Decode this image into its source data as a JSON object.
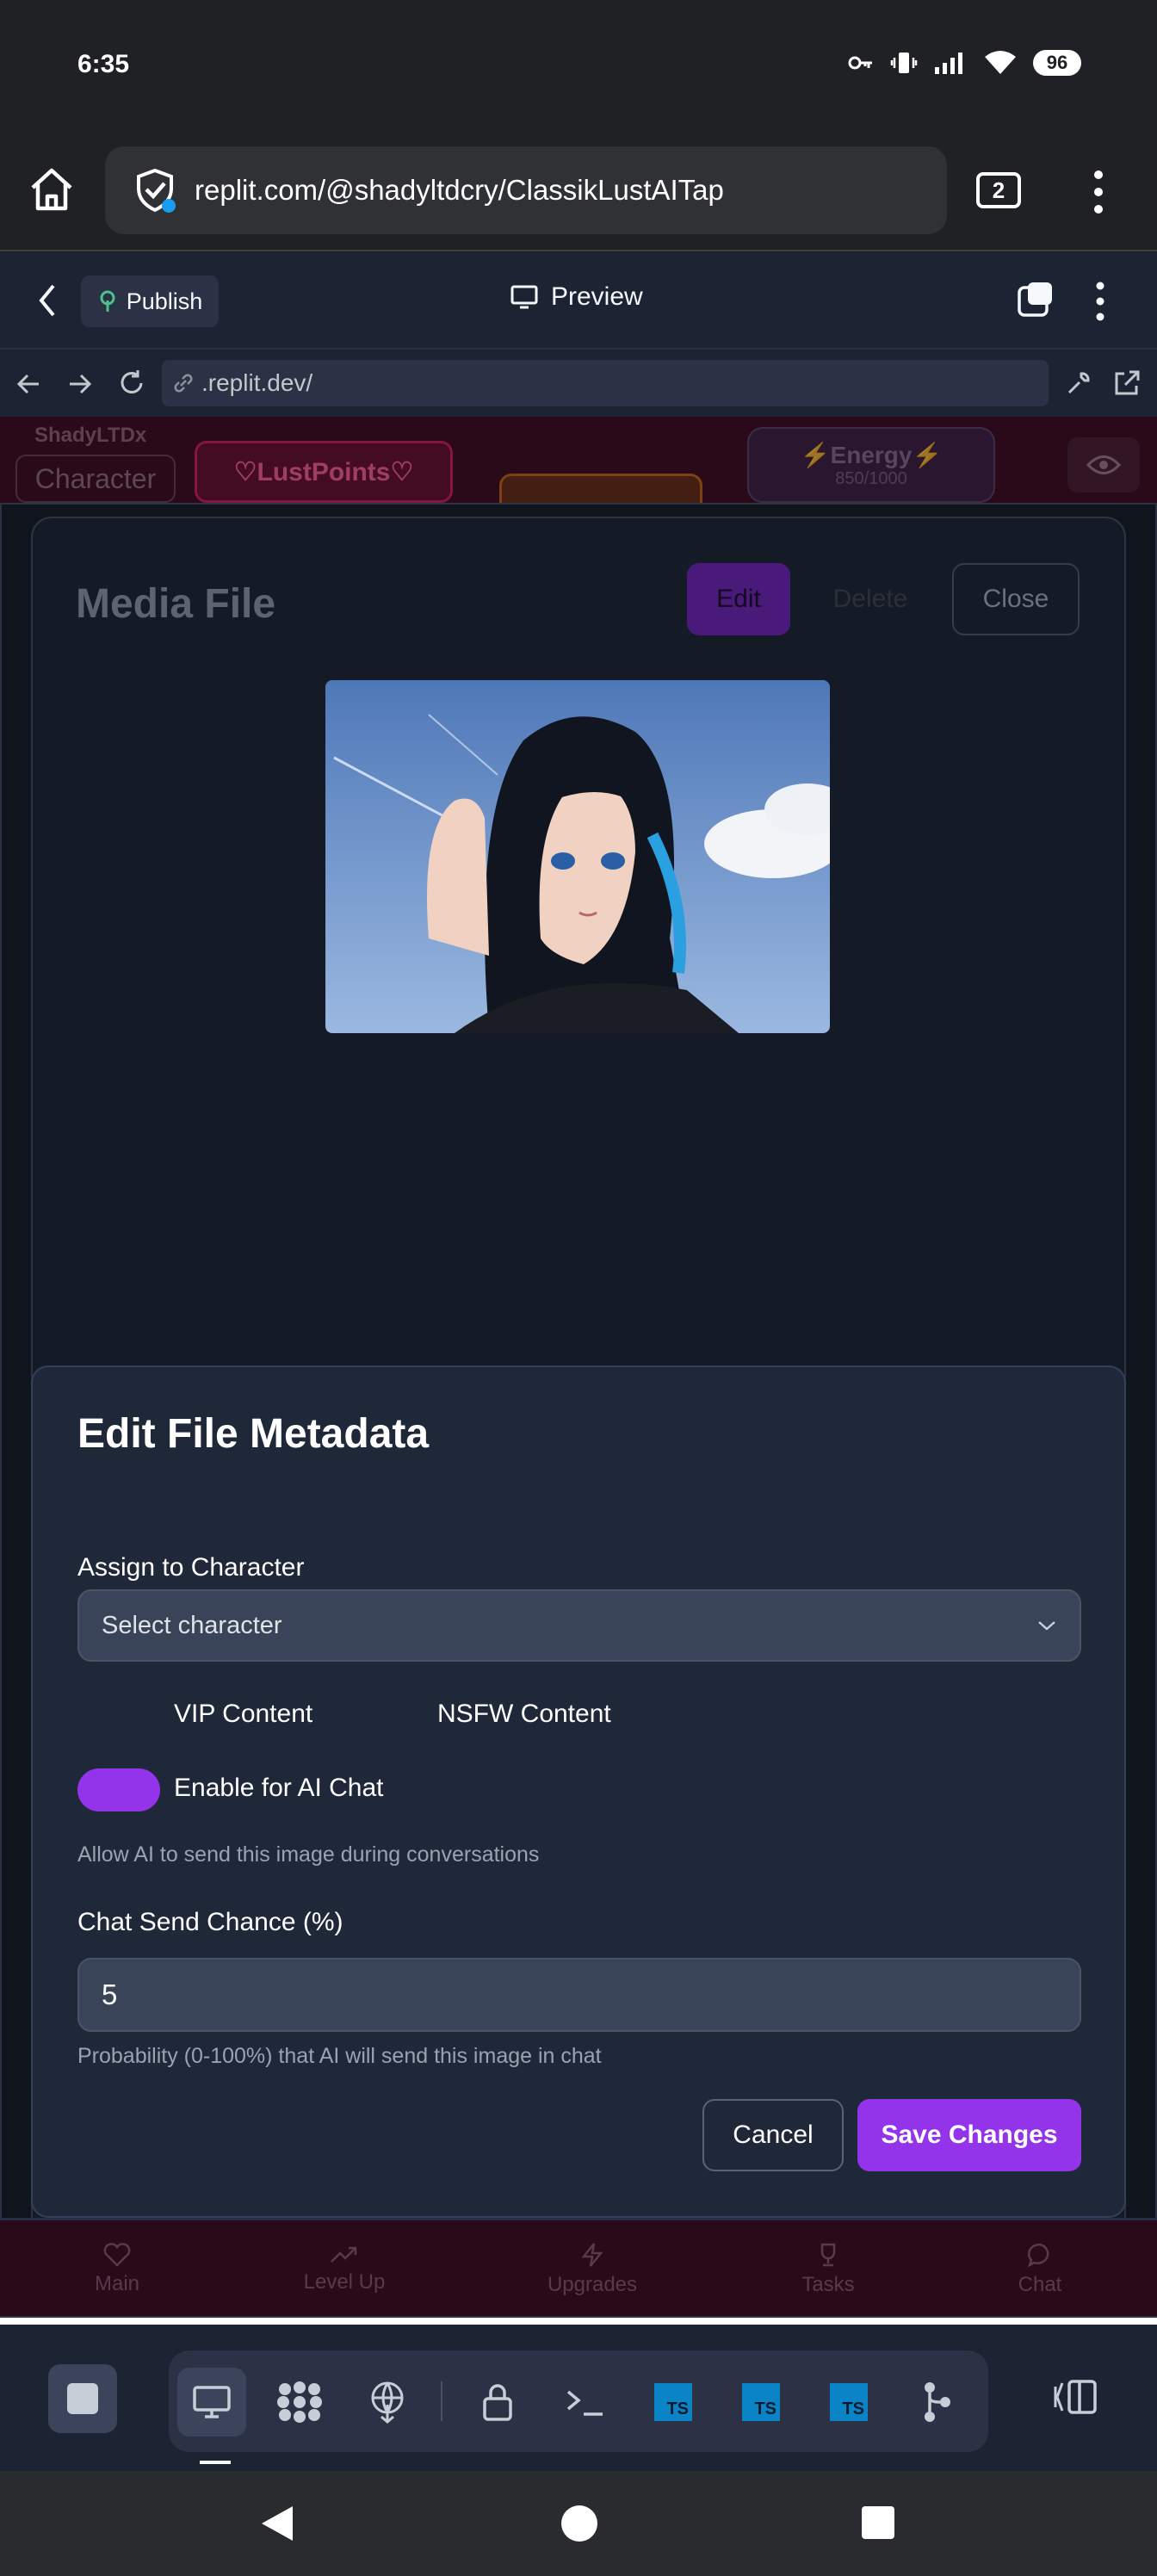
{
  "status_bar": {
    "time": "6:35",
    "battery": "96"
  },
  "browser": {
    "url": "replit.com/@shadyltdcry/ClassikLustAITap",
    "tab_count": "2"
  },
  "replit_header": {
    "publish_label": "Publish",
    "preview_label": "Preview"
  },
  "webview": {
    "url": ".replit.dev/"
  },
  "app_header": {
    "username": "ShadyLTDx",
    "character_label": "Character",
    "lustpoints_label": "♡LustPoints♡",
    "energy_label": "⚡Energy⚡",
    "energy_value": "850/1000"
  },
  "media_panel": {
    "title": "Media File",
    "edit_label": "Edit",
    "delete_label": "Delete",
    "close_label": "Close"
  },
  "dialog": {
    "title": "Edit File Metadata",
    "assign_label": "Assign to Character",
    "select_placeholder": "Select character",
    "vip_label": "VIP Content",
    "nsfw_label": "NSFW Content",
    "ai_chat_label": "Enable for AI Chat",
    "ai_chat_enabled": true,
    "ai_chat_hint": "Allow AI to send this image during conversations",
    "chance_label": "Chat Send Chance (%)",
    "chance_value": "5",
    "chance_hint": "Probability (0-100%) that AI will send this image in chat",
    "cancel_label": "Cancel",
    "save_label": "Save Changes"
  },
  "app_tabs": [
    {
      "label": "Main",
      "icon": "heart-icon"
    },
    {
      "label": "Level Up",
      "icon": "trending-up-icon"
    },
    {
      "label": "Upgrades",
      "icon": "zap-icon"
    },
    {
      "label": "Tasks",
      "icon": "trophy-icon"
    },
    {
      "label": "Chat",
      "icon": "chat-bubble-icon"
    }
  ],
  "colors": {
    "accent": "#9333ea",
    "dialog_bg": "#1f2839",
    "replit_bg": "#1c2333"
  }
}
